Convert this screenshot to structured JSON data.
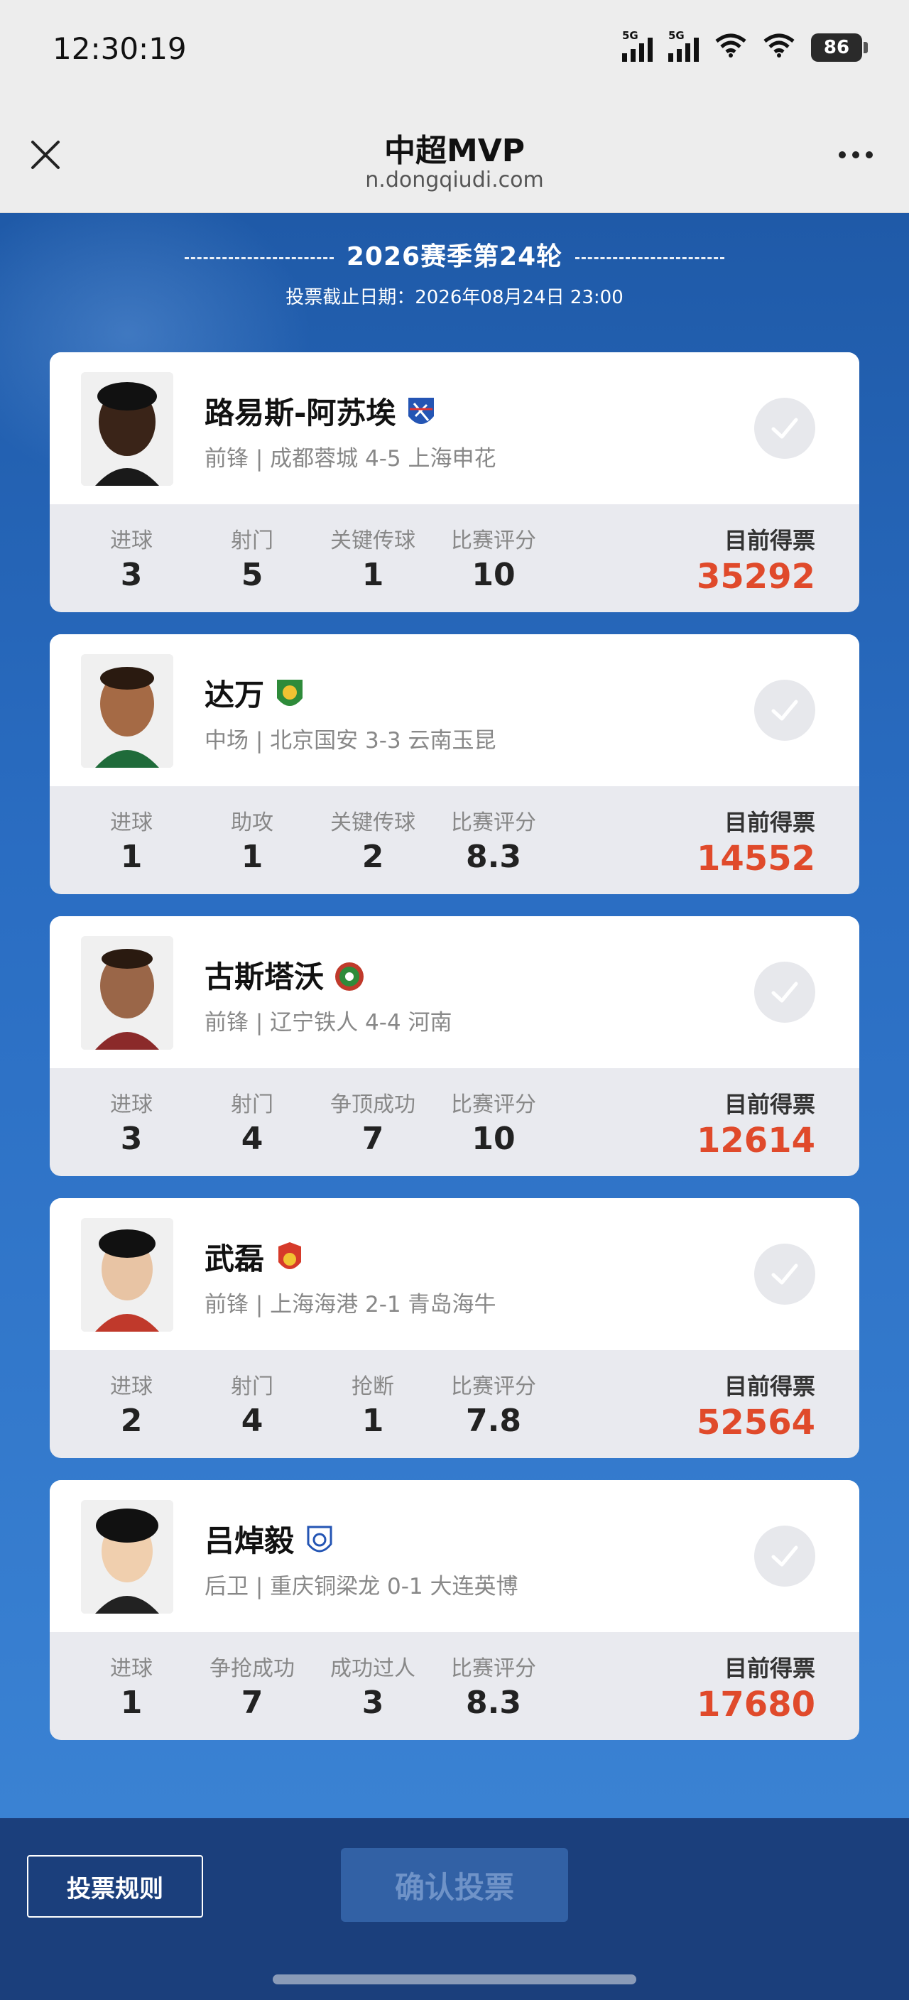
{
  "status_bar": {
    "time": "12:30:19",
    "signal1": "5G",
    "signal2": "5G",
    "battery": "86"
  },
  "header": {
    "title": "中超MVP",
    "url": "n.dongqiudi.com"
  },
  "round": {
    "title": "2026赛季第24轮",
    "deadline": "投票截止日期：2026年08月24日 23:00"
  },
  "players": [
    {
      "name": "路易斯-阿苏埃",
      "desc": "前锋 | 成都蓉城 4-5 上海申花",
      "stats": [
        {
          "label": "进球",
          "value": "3"
        },
        {
          "label": "射门",
          "value": "5"
        },
        {
          "label": "关键传球",
          "value": "1"
        },
        {
          "label": "比赛评分",
          "value": "10"
        }
      ],
      "votes_label": "目前得票",
      "votes": "35292"
    },
    {
      "name": "达万",
      "desc": "中场 | 北京国安 3-3 云南玉昆",
      "stats": [
        {
          "label": "进球",
          "value": "1"
        },
        {
          "label": "助攻",
          "value": "1"
        },
        {
          "label": "关键传球",
          "value": "2"
        },
        {
          "label": "比赛评分",
          "value": "8.3"
        }
      ],
      "votes_label": "目前得票",
      "votes": "14552"
    },
    {
      "name": "古斯塔沃",
      "desc": "前锋 | 辽宁铁人 4-4 河南",
      "stats": [
        {
          "label": "进球",
          "value": "3"
        },
        {
          "label": "射门",
          "value": "4"
        },
        {
          "label": "争顶成功",
          "value": "7"
        },
        {
          "label": "比赛评分",
          "value": "10"
        }
      ],
      "votes_label": "目前得票",
      "votes": "12614"
    },
    {
      "name": "武磊",
      "desc": "前锋 | 上海海港 2-1 青岛海牛",
      "stats": [
        {
          "label": "进球",
          "value": "2"
        },
        {
          "label": "射门",
          "value": "4"
        },
        {
          "label": "抢断",
          "value": "1"
        },
        {
          "label": "比赛评分",
          "value": "7.8"
        }
      ],
      "votes_label": "目前得票",
      "votes": "52564"
    },
    {
      "name": "吕焯毅",
      "desc": "后卫 | 重庆铜梁龙 0-1 大连英博",
      "stats": [
        {
          "label": "进球",
          "value": "1"
        },
        {
          "label": "争抢成功",
          "value": "7"
        },
        {
          "label": "成功过人",
          "value": "3"
        },
        {
          "label": "比赛评分",
          "value": "8.3"
        }
      ],
      "votes_label": "目前得票",
      "votes": "17680"
    }
  ],
  "footer": {
    "rules_label": "投票规则",
    "confirm_label": "确认投票"
  },
  "colors": {
    "accent_votes": "#e04a2b",
    "bg_blue": "#2a6dc2",
    "footer_blue": "#1b3f7c"
  }
}
